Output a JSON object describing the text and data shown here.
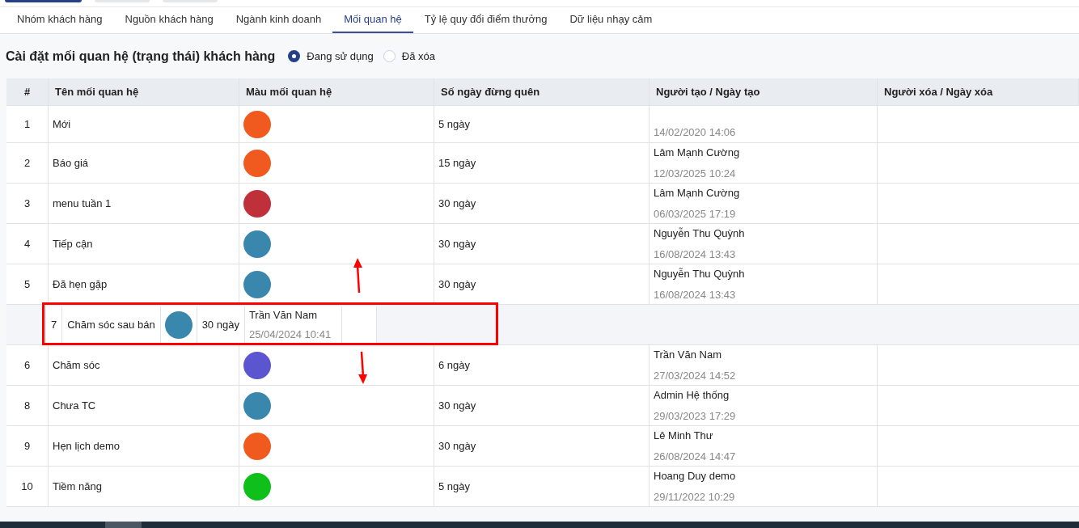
{
  "tabs": [
    {
      "label": "Nhóm khách hàng",
      "selected": false
    },
    {
      "label": "Nguồn khách hàng",
      "selected": false
    },
    {
      "label": "Ngành kinh doanh",
      "selected": false
    },
    {
      "label": "Mối quan hệ",
      "selected": true
    },
    {
      "label": "Tỷ lệ quy đổi điểm thưởng",
      "selected": false
    },
    {
      "label": "Dữ liệu nhạy cảm",
      "selected": false
    }
  ],
  "title": "Cài đặt mối quan hệ (trạng thái) khách hàng",
  "filter": [
    {
      "label": "Đang sử dụng",
      "selected": true
    },
    {
      "label": "Đã xóa",
      "selected": false
    }
  ],
  "table": {
    "columns": [
      "#",
      "Tên mối quan hệ",
      "Màu mối quan hệ",
      "Số ngày đừng quên",
      "Người tạo / Ngày tạo",
      "Người xóa / Ngày xóa"
    ],
    "rows": [
      {
        "index": "1",
        "name": "Mới",
        "color": "#f05a1e",
        "days": "5 ngày",
        "created_at": "14/02/2020 14:06"
      },
      {
        "index": "2",
        "name": "Báo giá",
        "color": "#f05a1e",
        "days": "15 ngày",
        "creator": "Lâm Mạnh Cường",
        "created_at": "12/03/2025 10:24"
      },
      {
        "index": "3",
        "name": "menu tuần 1",
        "color": "#c0303a",
        "days": "30 ngày",
        "creator": "Lâm Mạnh Cường",
        "created_at": "06/03/2025 17:19"
      },
      {
        "index": "4",
        "name": "Tiếp cận",
        "color": "#3a87ad",
        "days": "30 ngày",
        "creator": "Nguyễn Thu Quỳnh",
        "created_at": "16/08/2024 13:43"
      },
      {
        "index": "5",
        "name": "Đã hẹn gặp",
        "color": "#3a87ad",
        "days": "30 ngày",
        "creator": "Nguyễn Thu Quỳnh",
        "created_at": "16/08/2024 13:43",
        "drag_preview_below": {
          "item_number": "7",
          "name": "Chăm sóc sau bán",
          "color": "#3a87ad",
          "days": "30 ngày",
          "creator": "Trần Văn Nam",
          "created_at": "25/04/2024 10:41"
        }
      },
      {
        "index": "6",
        "name": "Chăm sóc",
        "color": "#5b55d0",
        "days": "6 ngày",
        "creator": "Trần Văn Nam",
        "created_at": "27/03/2024 14:52"
      },
      {
        "index": "8",
        "name": "Chưa TC",
        "color": "#3a87ad",
        "days": "30 ngày",
        "creator": "Admin Hệ thống",
        "created_at": "29/03/2023 17:29"
      },
      {
        "index": "9",
        "name": "Hẹn lịch demo",
        "color": "#f05a1e",
        "days": "30 ngày",
        "creator": "Lê Minh Thư",
        "created_at": "26/08/2024 14:47"
      },
      {
        "index": "10",
        "name": "Tiềm năng",
        "color": "#0fbf1a",
        "days": "5 ngày",
        "creator": "Hoang Duy demo",
        "created_at": "29/11/2022 10:29"
      }
    ]
  }
}
